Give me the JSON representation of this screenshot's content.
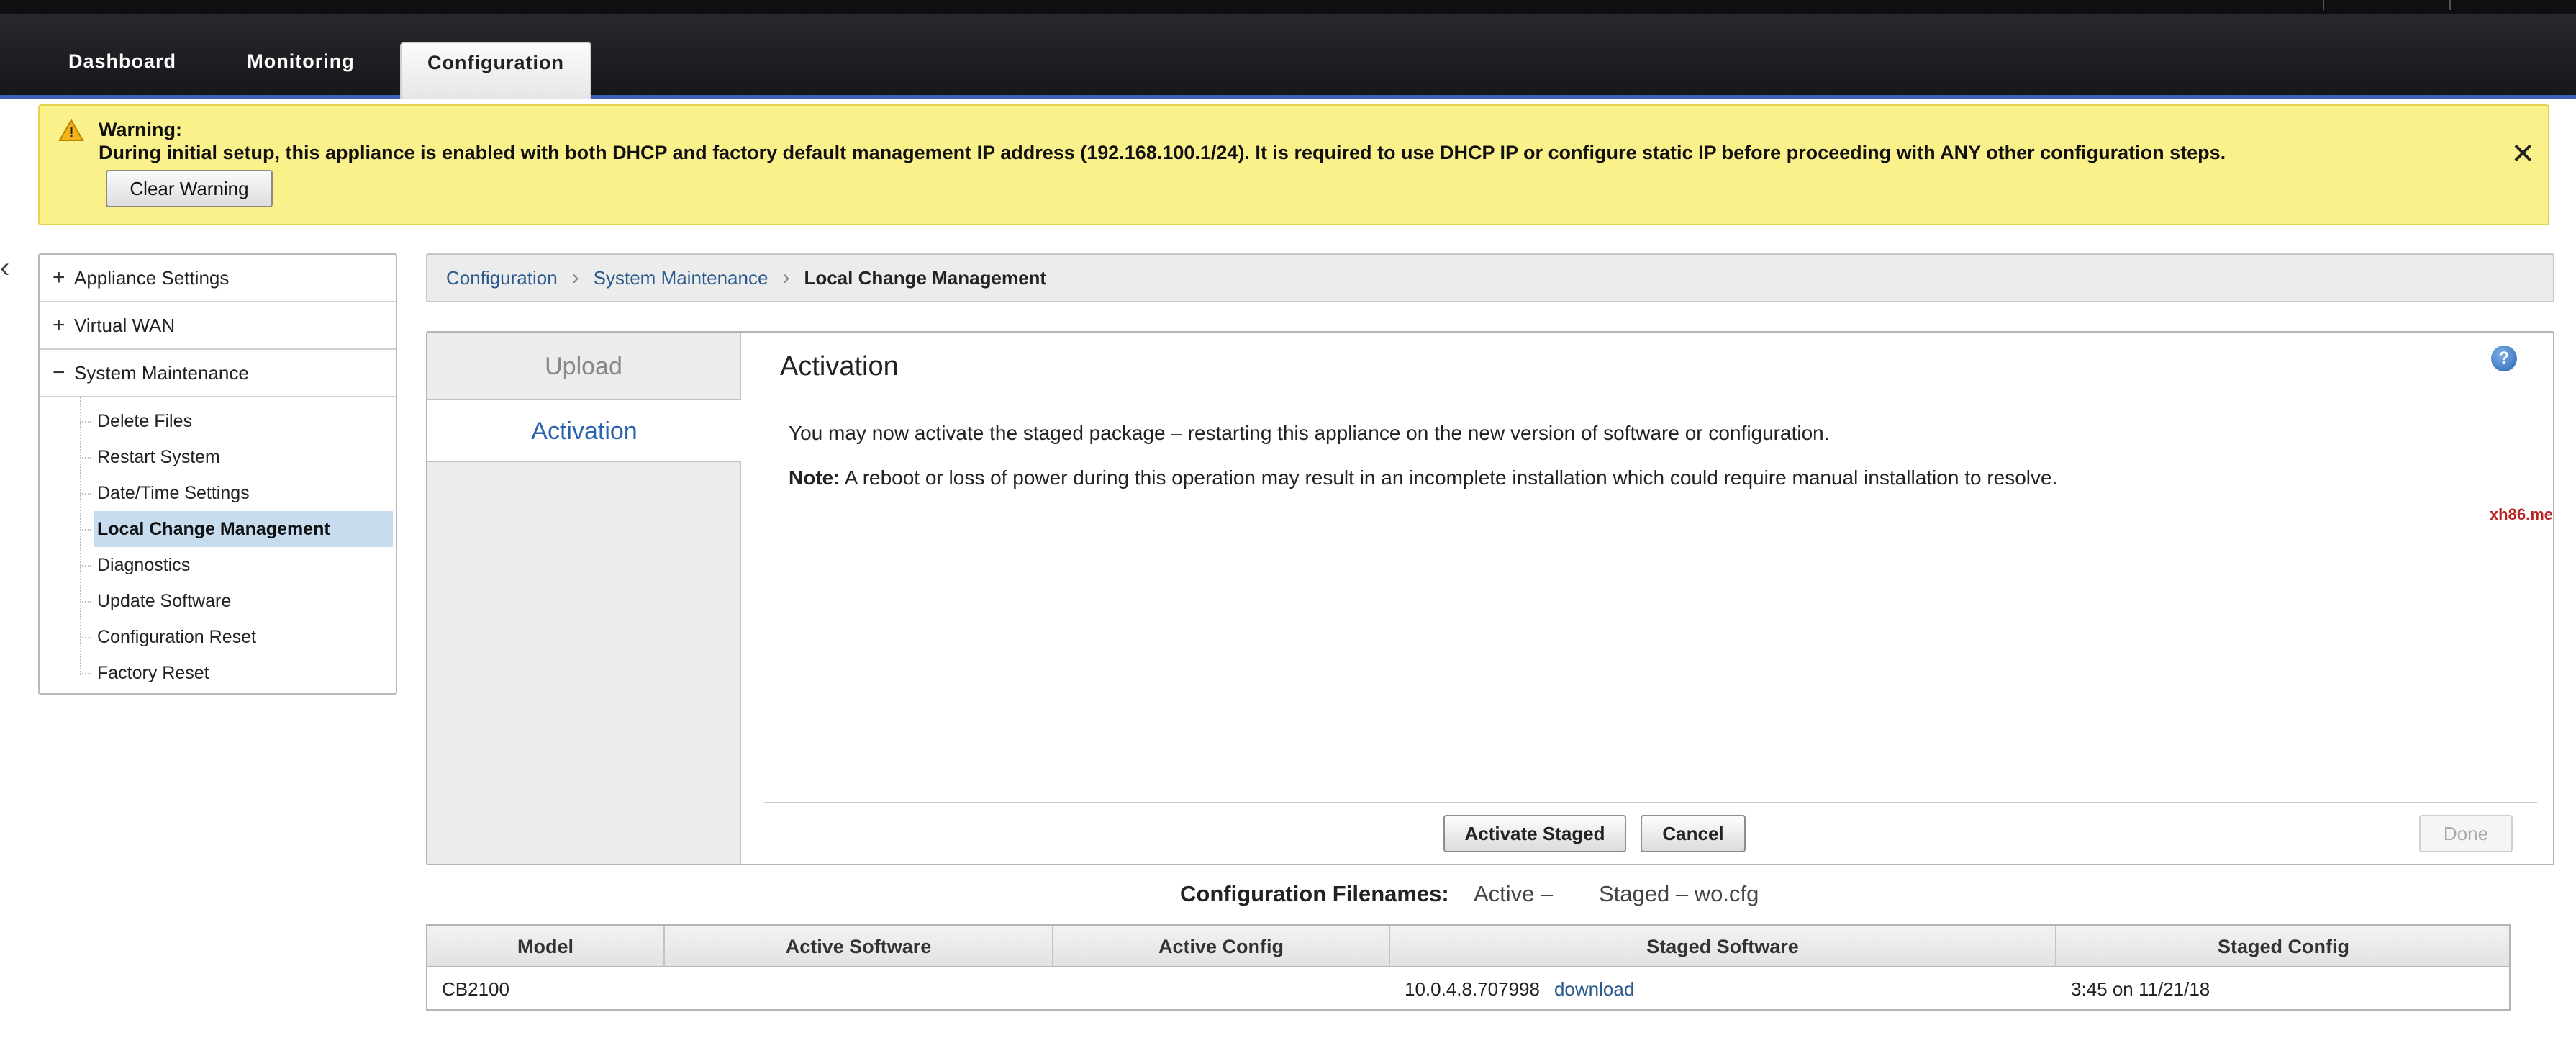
{
  "nav": {
    "tabs": [
      {
        "label": "Dashboard"
      },
      {
        "label": "Monitoring"
      },
      {
        "label": "Configuration"
      }
    ]
  },
  "warning": {
    "title": "Warning:",
    "text": "During initial setup, this appliance is enabled with both DHCP and factory default management IP address (192.168.100.1/24). It is required to use DHCP IP or configure static IP before proceeding with ANY other configuration steps.",
    "clear_label": "Clear Warning",
    "close_glyph": "✕"
  },
  "sidebar": {
    "groups": [
      {
        "sign": "+",
        "label": "Appliance Settings"
      },
      {
        "sign": "+",
        "label": "Virtual WAN"
      },
      {
        "sign": "−",
        "label": "System Maintenance"
      }
    ],
    "items": [
      {
        "label": "Delete Files"
      },
      {
        "label": "Restart System"
      },
      {
        "label": "Date/Time Settings"
      },
      {
        "label": "Local Change Management"
      },
      {
        "label": "Diagnostics"
      },
      {
        "label": "Update Software"
      },
      {
        "label": "Configuration Reset"
      },
      {
        "label": "Factory Reset"
      }
    ]
  },
  "breadcrumb": {
    "items": [
      "Configuration",
      "System Maintenance",
      "Local Change Management"
    ]
  },
  "panel": {
    "tabs": {
      "upload": "Upload",
      "activation": "Activation"
    },
    "title": "Activation",
    "help": "?",
    "message": "You may now activate the staged package – restarting this appliance on the new version of software or configuration.",
    "note_label": "Note:",
    "note_text": " A reboot or loss of power during this operation may result in an incomplete installation which could require manual installation to resolve.",
    "watermark": "xh86.me",
    "buttons": {
      "activate": "Activate Staged",
      "cancel": "Cancel",
      "done": "Done"
    }
  },
  "config_filenames": {
    "label": "Configuration Filenames:",
    "active": "Active –",
    "staged": "Staged – wo.cfg"
  },
  "table": {
    "columns": [
      "Model",
      "Active Software",
      "Active Config",
      "Staged Software",
      "Staged Config"
    ],
    "rows": [
      {
        "model": "CB2100",
        "active_software": "",
        "active_config": "",
        "staged_software": "10.0.4.8.707998",
        "staged_software_link": "download",
        "staged_config": "3:45 on 11/21/18"
      }
    ]
  },
  "colors": {
    "accent": "#2a62b0",
    "warning_bg": "#fbf18a",
    "selected": "#c8dcf0"
  }
}
